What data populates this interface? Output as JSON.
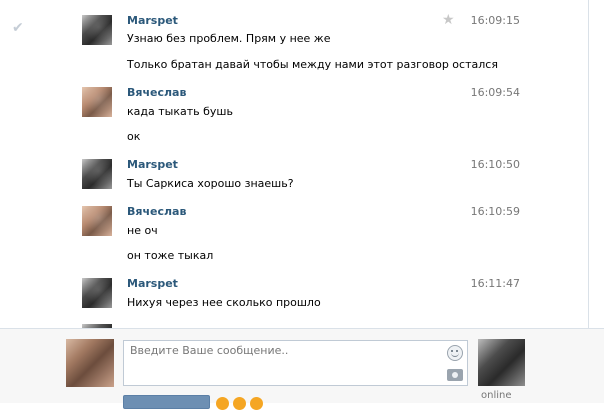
{
  "messages": [
    {
      "author": "Marspet",
      "time": "16:09:15",
      "lines": [
        "Узнаю без проблем. Прям у нее же",
        "Только братан давай чтобы между нами этот разговор остался"
      ],
      "starred": true,
      "checked": true
    },
    {
      "author": "Вячеслав",
      "time": "16:09:54",
      "lines": [
        "када тыкать бушь",
        "ок"
      ]
    },
    {
      "author": "Marspet",
      "time": "16:10:50",
      "lines": [
        "Ты Саркиса хорошо знаешь?"
      ]
    },
    {
      "author": "Вячеслав",
      "time": "16:10:59",
      "lines": [
        "не оч",
        "он тоже тыкал"
      ]
    },
    {
      "author": "Marspet",
      "time": "16:11:47",
      "lines": [
        "Нихуя через нее сколько прошло"
      ]
    }
  ],
  "composer": {
    "placeholder": "Введите Ваше сообщение..",
    "status": "online"
  }
}
